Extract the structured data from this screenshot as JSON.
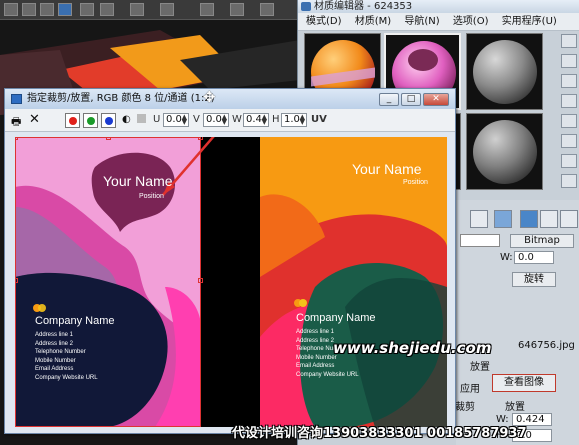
{
  "material_editor": {
    "title": "材质编辑器 - 624353",
    "menu": [
      "模式(D)",
      "材质(M)",
      "导航(N)",
      "选项(O)",
      "实用程序(U)"
    ],
    "bitmap_label": "Bitmap",
    "w_label": "W:",
    "w_value": "0.0",
    "rotate_label": "旋转",
    "file_label": "646756.jpg",
    "apply_label": "应用",
    "view_image_label": "查看图像",
    "place_label": "放置",
    "crop_label": "裁剪",
    "w2_label": "W:",
    "w2_value": "0.424",
    "h_label": "H:",
    "h_value": "0.0"
  },
  "dialog": {
    "title": "指定裁剪/放置, RGB 颜色 8 位/通道 (1:2)",
    "minimize": "_",
    "maximize": "□",
    "close": "✕",
    "toolbar": {
      "u_label": "U",
      "u_value": "0.0",
      "v_label": "V",
      "v_value": "0.0",
      "w_label": "W",
      "w_value": "0.4",
      "h_label": "H",
      "h_value": "1.0",
      "uv_label": "UV"
    }
  },
  "card_front": {
    "name": "Your Name",
    "position": "Position",
    "company": "Company Name",
    "lines": [
      "Address line 1",
      "Address line 2",
      "Telephone Number",
      "Mobile Number",
      "Email Address",
      "Company Website URL"
    ]
  },
  "card_back": {
    "name": "Your Name",
    "position": "Position",
    "company": "Company Name",
    "lines": [
      "Address line 1",
      "Address line 2",
      "Telephone Number",
      "Mobile Number",
      "Email Address",
      "Company Website URL"
    ]
  },
  "watermark": {
    "site": "www.shejiedu.com",
    "footer": "代设计培训咨询13903833301  00185787937"
  },
  "colors": {
    "accent_red": "#e0312d",
    "card_pink": "#f29fd8",
    "card_orange": "#f79a12",
    "card_navy": "#111838",
    "card_green": "#1a5c48"
  }
}
